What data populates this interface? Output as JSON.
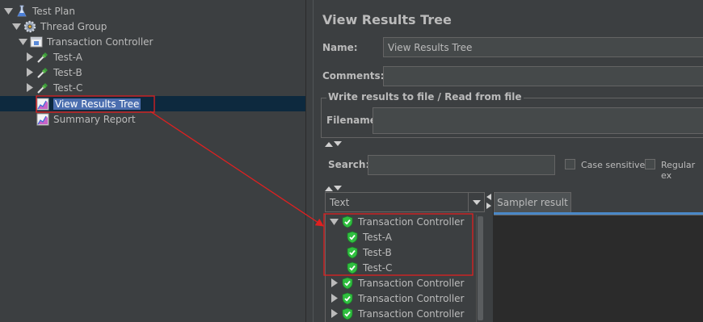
{
  "tree": {
    "items": [
      {
        "label": "Test Plan",
        "icon": "flask-icon"
      },
      {
        "label": "Thread Group",
        "icon": "gear-icon"
      },
      {
        "label": "Transaction Controller",
        "icon": "controller-icon"
      },
      {
        "label": "Test-A",
        "icon": "pipette-icon"
      },
      {
        "label": "Test-B",
        "icon": "pipette-icon"
      },
      {
        "label": "Test-C",
        "icon": "pipette-icon"
      },
      {
        "label": "View Results Tree",
        "icon": "chart-icon",
        "selected": true
      },
      {
        "label": "Summary Report",
        "icon": "chart-icon"
      }
    ]
  },
  "panel": {
    "title": "View Results Tree",
    "name_label": "Name:",
    "name_value": "View Results Tree",
    "comments_label": "Comments:",
    "comments_value": "",
    "file_group_title": "Write results to file / Read from file",
    "filename_label": "Filename",
    "filename_value": ""
  },
  "search": {
    "label": "Search:",
    "value": "",
    "case_sensitive_label": "Case sensitive",
    "regex_label": "Regular ex"
  },
  "renderer": {
    "selected": "Text"
  },
  "results": {
    "items": [
      {
        "label": "Transaction Controller",
        "level": 0,
        "expanded": true
      },
      {
        "label": "Test-A",
        "level": 1
      },
      {
        "label": "Test-B",
        "level": 1
      },
      {
        "label": "Test-C",
        "level": 1
      },
      {
        "label": "Transaction Controller",
        "level": 0,
        "expanded": false
      },
      {
        "label": "Transaction Controller",
        "level": 0,
        "expanded": false
      },
      {
        "label": "Transaction Controller",
        "level": 0,
        "expanded": false
      }
    ]
  },
  "sampler": {
    "tab_label": "Sampler result"
  },
  "colors": {
    "background": "#3c3f41",
    "selection": "#4b6eaf",
    "annotation": "#e02020",
    "success_shield": "#2fbf3f"
  }
}
